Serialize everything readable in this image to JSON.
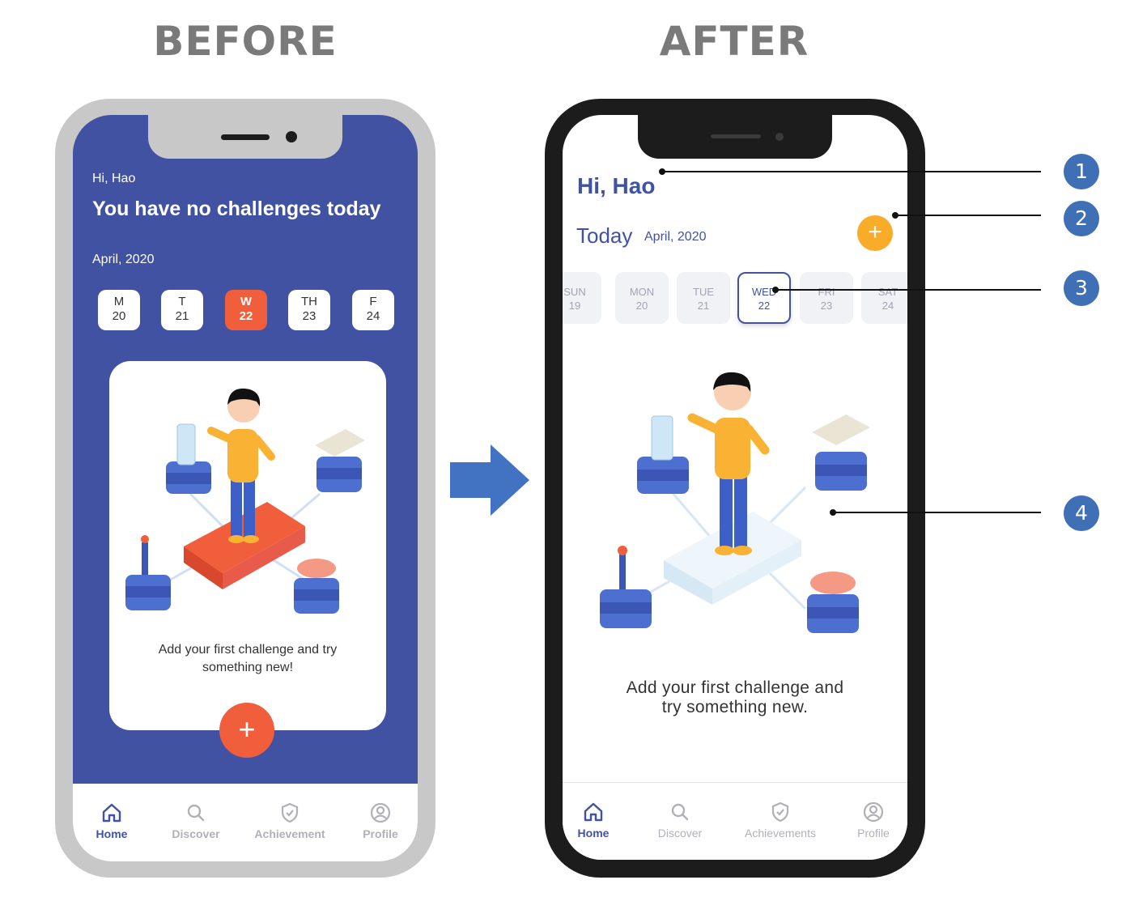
{
  "headings": {
    "before": "BEFORE",
    "after": "AFTER"
  },
  "before": {
    "greeting": "Hi, Hao",
    "title": "You have no challenges today",
    "month": "April, 2020",
    "days": [
      {
        "abbr": "M",
        "num": "20"
      },
      {
        "abbr": "T",
        "num": "21"
      },
      {
        "abbr": "W",
        "num": "22"
      },
      {
        "abbr": "TH",
        "num": "23"
      },
      {
        "abbr": "F",
        "num": "24"
      }
    ],
    "selected_day": "W 22",
    "empty_text_line1": "Add your first challenge and try",
    "empty_text_line2": "something new!",
    "add_symbol": "+",
    "tabs": [
      "Home",
      "Discover",
      "Achievement",
      "Profile"
    ],
    "active_tab": "Home",
    "colors": {
      "background": "#4152a3",
      "accent": "#f15e3b"
    }
  },
  "after": {
    "greeting": "Hi, Hao",
    "today": "Today",
    "month": "April, 2020",
    "add_symbol": "+",
    "days": [
      {
        "abbr": "SUN",
        "num": "19"
      },
      {
        "abbr": "MON",
        "num": "20"
      },
      {
        "abbr": "TUE",
        "num": "21"
      },
      {
        "abbr": "WED",
        "num": "22"
      },
      {
        "abbr": "FRI",
        "num": "23"
      },
      {
        "abbr": "SAT",
        "num": "24"
      }
    ],
    "selected_day": "WED 22",
    "empty_text_line1": "Add your first challenge and",
    "empty_text_line2": "try something new.",
    "tabs": [
      "Home",
      "Discover",
      "Achievements",
      "Profile"
    ],
    "active_tab": "Home",
    "colors": {
      "primary": "#4152a3",
      "accent": "#f9ac2a"
    }
  },
  "callouts": [
    "1",
    "2",
    "3",
    "4"
  ]
}
